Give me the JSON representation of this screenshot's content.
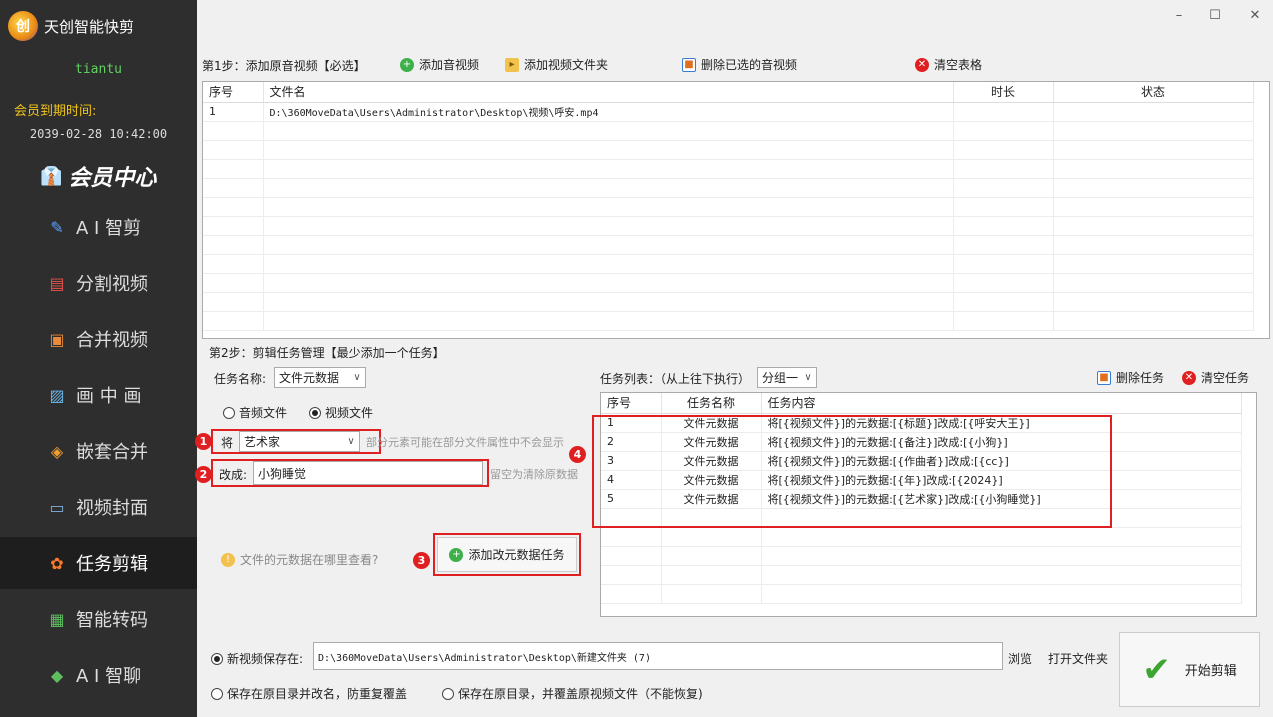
{
  "sidebar": {
    "app_name": "天创智能快剪",
    "logo_text": "创",
    "username": "tiantu",
    "expire_label": "会员到期时间:",
    "expire_value": "2039-02-28 10:42:00",
    "vip_label": "会员中心",
    "nav": [
      {
        "label": "A I 智剪",
        "icon": "pen-icon"
      },
      {
        "label": "分割视频",
        "icon": "layers-icon"
      },
      {
        "label": "合并视频",
        "icon": "merge-icon"
      },
      {
        "label": "画 中 画",
        "icon": "picture-icon"
      },
      {
        "label": "嵌套合并",
        "icon": "nest-icon"
      },
      {
        "label": "视频封面",
        "icon": "cover-icon"
      },
      {
        "label": "任务剪辑",
        "icon": "gear-icon"
      },
      {
        "label": "智能转码",
        "icon": "convert-icon"
      },
      {
        "label": "A I 智聊",
        "icon": "chat-icon"
      }
    ],
    "active_index": 6
  },
  "window": {
    "minimize": "–",
    "maximize": "☐",
    "close": "✕"
  },
  "step1": {
    "title": "第1步：添加原音视频【必选】",
    "add_video": "添加音视频",
    "add_folder": "添加视频文件夹",
    "delete_selected": "删除已选的音视频",
    "clear_table": "清空表格",
    "columns": [
      "序号",
      "文件名",
      "时长",
      "状态"
    ],
    "rows": [
      {
        "index": "1",
        "filename": "D:\\360MoveData\\Users\\Administrator\\Desktop\\视频\\呼安.mp4",
        "duration": "",
        "status": ""
      }
    ]
  },
  "step2": {
    "title": "第2步：剪辑任务管理【最少添加一个任务】",
    "task_name_label": "任务名称:",
    "task_name_value": "文件元数据",
    "radio_audio": "音频文件",
    "radio_video": "视频文件",
    "will_label": "将",
    "field_value": "艺术家",
    "field_hint": "部分元素可能在部分文件属性中不会显示",
    "change_label": "改成:",
    "change_value": "小狗睡觉",
    "change_hint": "留空为清除原数据",
    "help_link": "文件的元数据在哪里查看?",
    "add_task_button": "添加改元数据任务",
    "badges": [
      "1",
      "2",
      "3",
      "4"
    ],
    "task_list_label": "任务列表：（从上往下执行）",
    "group_value": "分组一",
    "delete_task": "删除任务",
    "clear_task": "清空任务",
    "task_columns": [
      "序号",
      "任务名称",
      "任务内容"
    ],
    "tasks": [
      {
        "index": "1",
        "name": "文件元数据",
        "content": "将[{视频文件}]的元数据:[{标题}]改成:[{呼安大王}]"
      },
      {
        "index": "2",
        "name": "文件元数据",
        "content": "将[{视频文件}]的元数据:[{备注}]改成:[{小狗}]"
      },
      {
        "index": "3",
        "name": "文件元数据",
        "content": "将[{视频文件}]的元数据:[{作曲者}]改成:[{cc}]"
      },
      {
        "index": "4",
        "name": "文件元数据",
        "content": "将[{视频文件}]的元数据:[{年}]改成:[{2024}]"
      },
      {
        "index": "5",
        "name": "文件元数据",
        "content": "将[{视频文件}]的元数据:[{艺术家}]改成:[{小狗睡觉}]"
      }
    ]
  },
  "save": {
    "new_save_label": "新视频保存在:",
    "path": "D:\\360MoveData\\Users\\Administrator\\Desktop\\新建文件夹 (7)",
    "browse": "浏览",
    "open_folder": "打开文件夹",
    "option_rename": "保存在原目录并改名，防重复覆盖",
    "option_overwrite": "保存在原目录，并覆盖原视频文件（不能恢复)",
    "start_button": "开始剪辑"
  },
  "colors": {
    "sidebar_bg": "#2e2e2e",
    "accent_red": "#e02020",
    "user_green": "#5fd35f",
    "expire_yellow": "#f0c419"
  }
}
